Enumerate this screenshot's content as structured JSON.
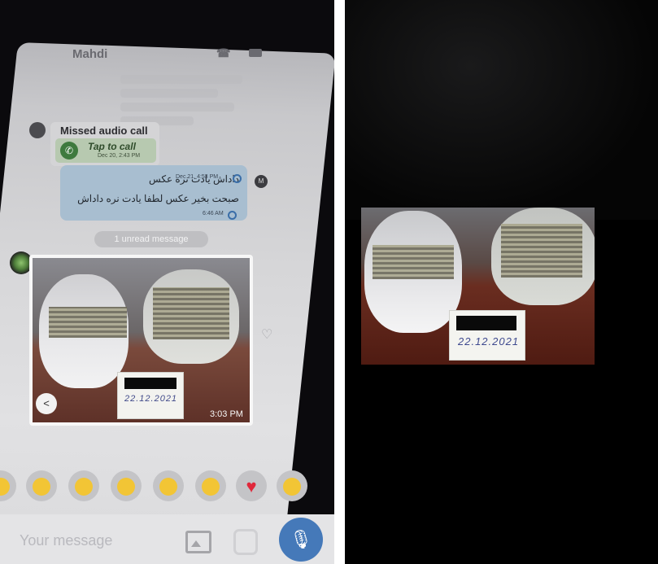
{
  "chat": {
    "contact_name": "Mahdi",
    "missed_call": {
      "title": "Missed audio call",
      "action": "Tap to call",
      "time": "Dec 20, 2:43 PM"
    },
    "messages": [
      {
        "text": "داداش یادت نره عکس",
        "time": "Dec 21, 4:53 PM"
      },
      {
        "text": "صبحت بخیر عکس لطفا یادت نره داداش",
        "time": "6:46 AM"
      }
    ],
    "sender_initial": "M",
    "unread_label": "1 unread message",
    "image_message": {
      "note_date": "22.12.2021",
      "time": "3:03 PM"
    },
    "input": {
      "placeholder": "Your message"
    },
    "emoji_icons": [
      "hand-icon",
      "clap-icon",
      "thumbs-up-icon",
      "smile-icon",
      "heart-eyes-icon",
      "surprised-icon",
      "heart-icon",
      "neutral-face-icon"
    ]
  },
  "evidence_photo": {
    "note_date": "22.12.2021"
  },
  "colors": {
    "bubble": "#a8bed0",
    "mic_button": "#4579b9",
    "table": "#6a2d20"
  }
}
